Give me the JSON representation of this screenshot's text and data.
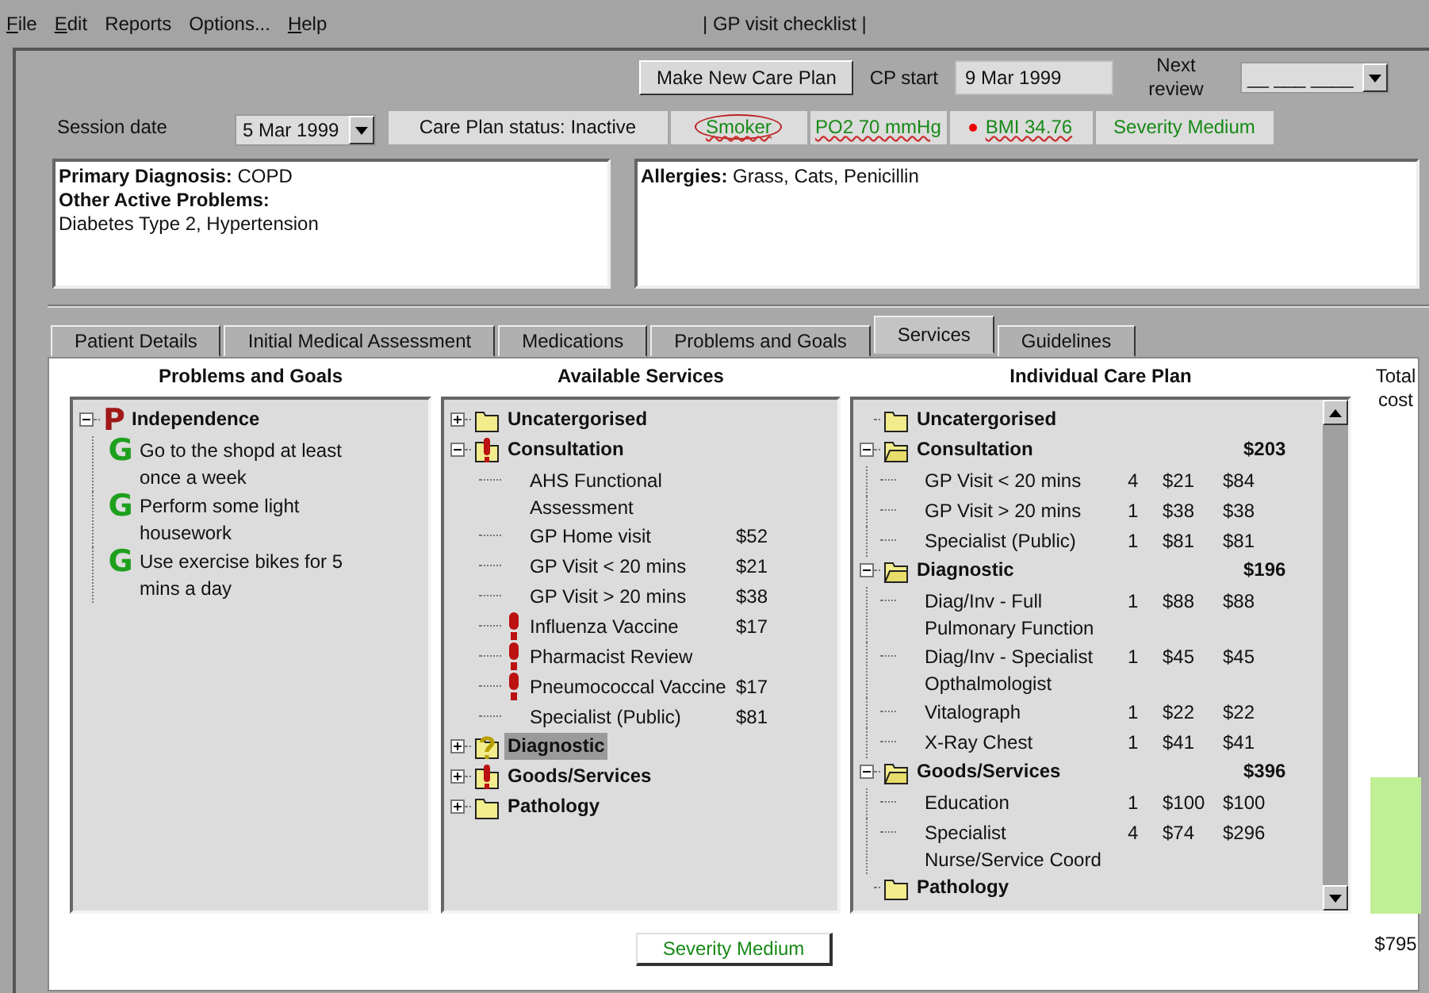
{
  "menu": [
    {
      "label": "File",
      "mnemonic": true
    },
    {
      "label": "Edit",
      "mnemonic": true
    },
    {
      "label": "Reports",
      "mnemonic": false
    },
    {
      "label": "Options...",
      "mnemonic": false
    },
    {
      "label": "Help",
      "mnemonic": true
    }
  ],
  "window": {
    "title": "| GP visit checklist |"
  },
  "header": {
    "make_plan_button": "Make New Care Plan",
    "cp_start": {
      "label": "CP start",
      "value": "9  Mar 1999"
    },
    "next_review": {
      "label": "Next review",
      "value": "__ ___ ____"
    },
    "session_date": {
      "label": "Session date",
      "value": "5  Mar 1999"
    },
    "status": "Care Plan status: Inactive",
    "indicators": [
      {
        "label": "Smoker",
        "kind": "circled",
        "squiggle": true
      },
      {
        "label": "PO2 70 mmHg",
        "kind": "plain",
        "squiggle": true
      },
      {
        "label": "BMI  34.76",
        "kind": "dot",
        "squiggle": true
      },
      {
        "label": "Severity Medium",
        "kind": "plain",
        "squiggle": false
      }
    ]
  },
  "diagnosis": [
    "**Primary Diagnosis:** COPD",
    "**Other Active Problems:**",
    " Diabetes Type 2, Hypertension"
  ],
  "allergies": "**Allergies:**  Grass, Cats, Penicillin",
  "tabs": [
    {
      "label": "Patient Details",
      "selected": false
    },
    {
      "label": "Initial Medical Assessment",
      "selected": false
    },
    {
      "label": "Medications",
      "selected": false
    },
    {
      "label": "Problems and Goals",
      "selected": false
    },
    {
      "label": "Services",
      "selected": true
    },
    {
      "label": "Guidelines",
      "selected": false
    }
  ],
  "problems": {
    "title": "Problems and Goals",
    "items": [
      {
        "badge": "P",
        "label": "Independence",
        "expanded": true,
        "children": [
          {
            "badge": "G",
            "label": "Go to the shopd at least once a week"
          },
          {
            "badge": "G",
            "label": "Perform some light housework"
          },
          {
            "badge": "G",
            "label": "Use exercise bikes for 5 mins a day"
          }
        ]
      }
    ]
  },
  "available": {
    "title": "Available Services",
    "categories": [
      {
        "label": "Uncatergorised",
        "kind": "folder",
        "expanded": false,
        "selected": false
      },
      {
        "label": "Consultation",
        "kind": "alert",
        "expanded": true,
        "selected": false,
        "children": [
          {
            "label": "AHS Functional Assessment",
            "alert": false
          },
          {
            "label": "GP Home visit",
            "price": "$52",
            "alert": false
          },
          {
            "label": "GP Visit < 20 mins",
            "price": "$21",
            "alert": false
          },
          {
            "label": "GP Visit > 20 mins",
            "price": "$38",
            "alert": false
          },
          {
            "label": "Influenza Vaccine",
            "price": "$17",
            "alert": true
          },
          {
            "label": "Pharmacist Review",
            "alert": true
          },
          {
            "label": "Pneumococcal Vaccine",
            "price": "$17",
            "alert": true
          },
          {
            "label": "Specialist (Public)",
            "price": "$81",
            "alert": false
          }
        ]
      },
      {
        "label": "Diagnostic",
        "kind": "question",
        "expanded": false,
        "selected": true
      },
      {
        "label": "Goods/Services",
        "kind": "alert",
        "expanded": false,
        "selected": false
      },
      {
        "label": "Pathology",
        "kind": "folder",
        "expanded": false,
        "selected": false
      }
    ]
  },
  "care_plan": {
    "title": "Individual Care Plan",
    "categories": [
      {
        "label": "Uncatergorised"
      },
      {
        "label": "Consultation",
        "total": "$203",
        "expanded": true,
        "children": [
          {
            "label": "GP Visit < 20 mins",
            "qty": "4",
            "unit": "$21",
            "total": "$84"
          },
          {
            "label": "GP Visit > 20 mins",
            "qty": "1",
            "unit": "$38",
            "total": "$38"
          },
          {
            "label": "Specialist (Public)",
            "qty": "1",
            "unit": "$81",
            "total": "$81"
          }
        ]
      },
      {
        "label": "Diagnostic",
        "total": "$196",
        "expanded": true,
        "children": [
          {
            "label": "Diag/Inv - Full Pulmonary Function",
            "qty": "1",
            "unit": "$88",
            "total": "$88"
          },
          {
            "label": "Diag/Inv - Specialist Opthalmologist",
            "qty": "1",
            "unit": "$45",
            "total": "$45"
          },
          {
            "label": "Vitalograph",
            "qty": "1",
            "unit": "$22",
            "total": "$22"
          },
          {
            "label": "X-Ray Chest",
            "qty": "1",
            "unit": "$41",
            "total": "$41"
          }
        ]
      },
      {
        "label": "Goods/Services",
        "total": "$396",
        "expanded": true,
        "children": [
          {
            "label": "Education",
            "qty": "1",
            "unit": "$100",
            "total": "$100"
          },
          {
            "label": "Specialist Nurse/Service Coord",
            "qty": "4",
            "unit": "$74",
            "total": "$296"
          }
        ]
      },
      {
        "label": "Pathology"
      }
    ]
  },
  "total_cost": {
    "label": "Total cost",
    "value": "$795"
  },
  "severity_button": "Severity Medium"
}
